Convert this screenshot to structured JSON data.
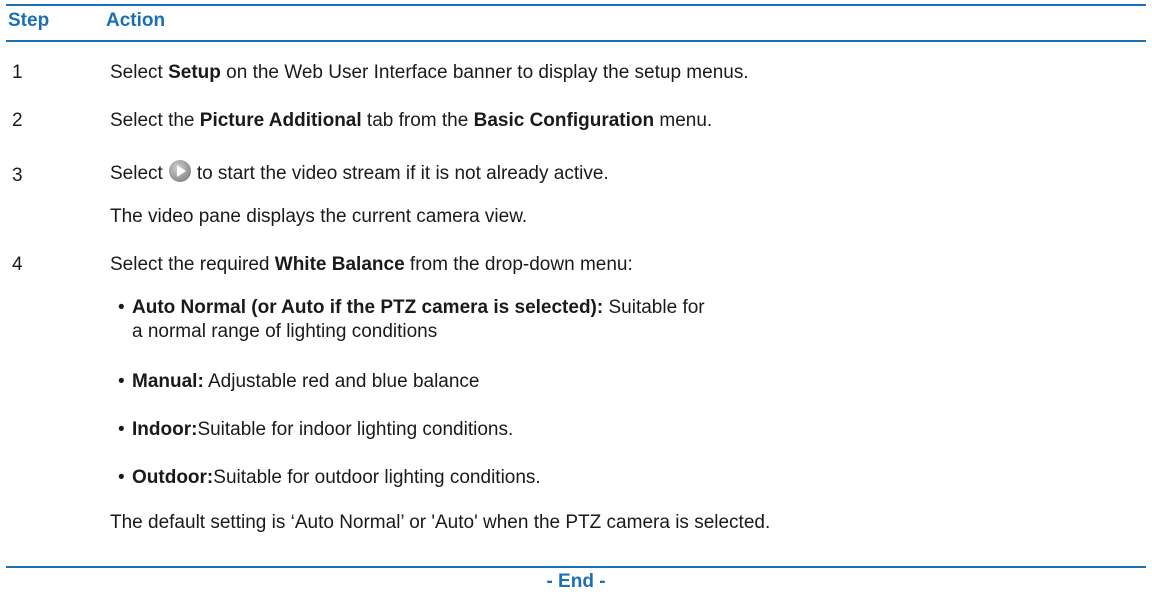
{
  "header": {
    "step": "Step",
    "action": "Action"
  },
  "steps": [
    {
      "num": "1",
      "a": "Select ",
      "b": "Setup",
      "c": " on the Web User Interface banner to display the setup menus."
    },
    {
      "num": "2",
      "a": "Select the ",
      "b": "Picture Additional",
      "c": " tab from the ",
      "d": "Basic Configuration",
      "e": " menu."
    },
    {
      "num": "3",
      "a": "Select",
      "b": "to start the video stream if it is not already active.",
      "note": "The video pane displays the current camera view.",
      "icon": "play-icon"
    },
    {
      "num": "4",
      "a": "Select the required ",
      "b": "White Balance",
      "c": " from the drop-down menu:"
    }
  ],
  "options": [
    {
      "label": "Auto Normal (or Auto if the PTZ camera is selected):",
      "desc": " Suitable for",
      "desc2": "a normal range of lighting conditions"
    },
    {
      "label": "Manual:",
      "desc": " Adjustable red and blue balance"
    },
    {
      "label": "Indoor:",
      "desc": "Suitable for indoor lighting conditions."
    },
    {
      "label": "Outdoor:",
      "desc": "Suitable for outdoor lighting conditions."
    }
  ],
  "default_note": "The default setting is ‘Auto Normal’ or 'Auto' when the PTZ camera is selected.",
  "end": "- End -",
  "colors": {
    "accent": "#1d6fb5"
  }
}
